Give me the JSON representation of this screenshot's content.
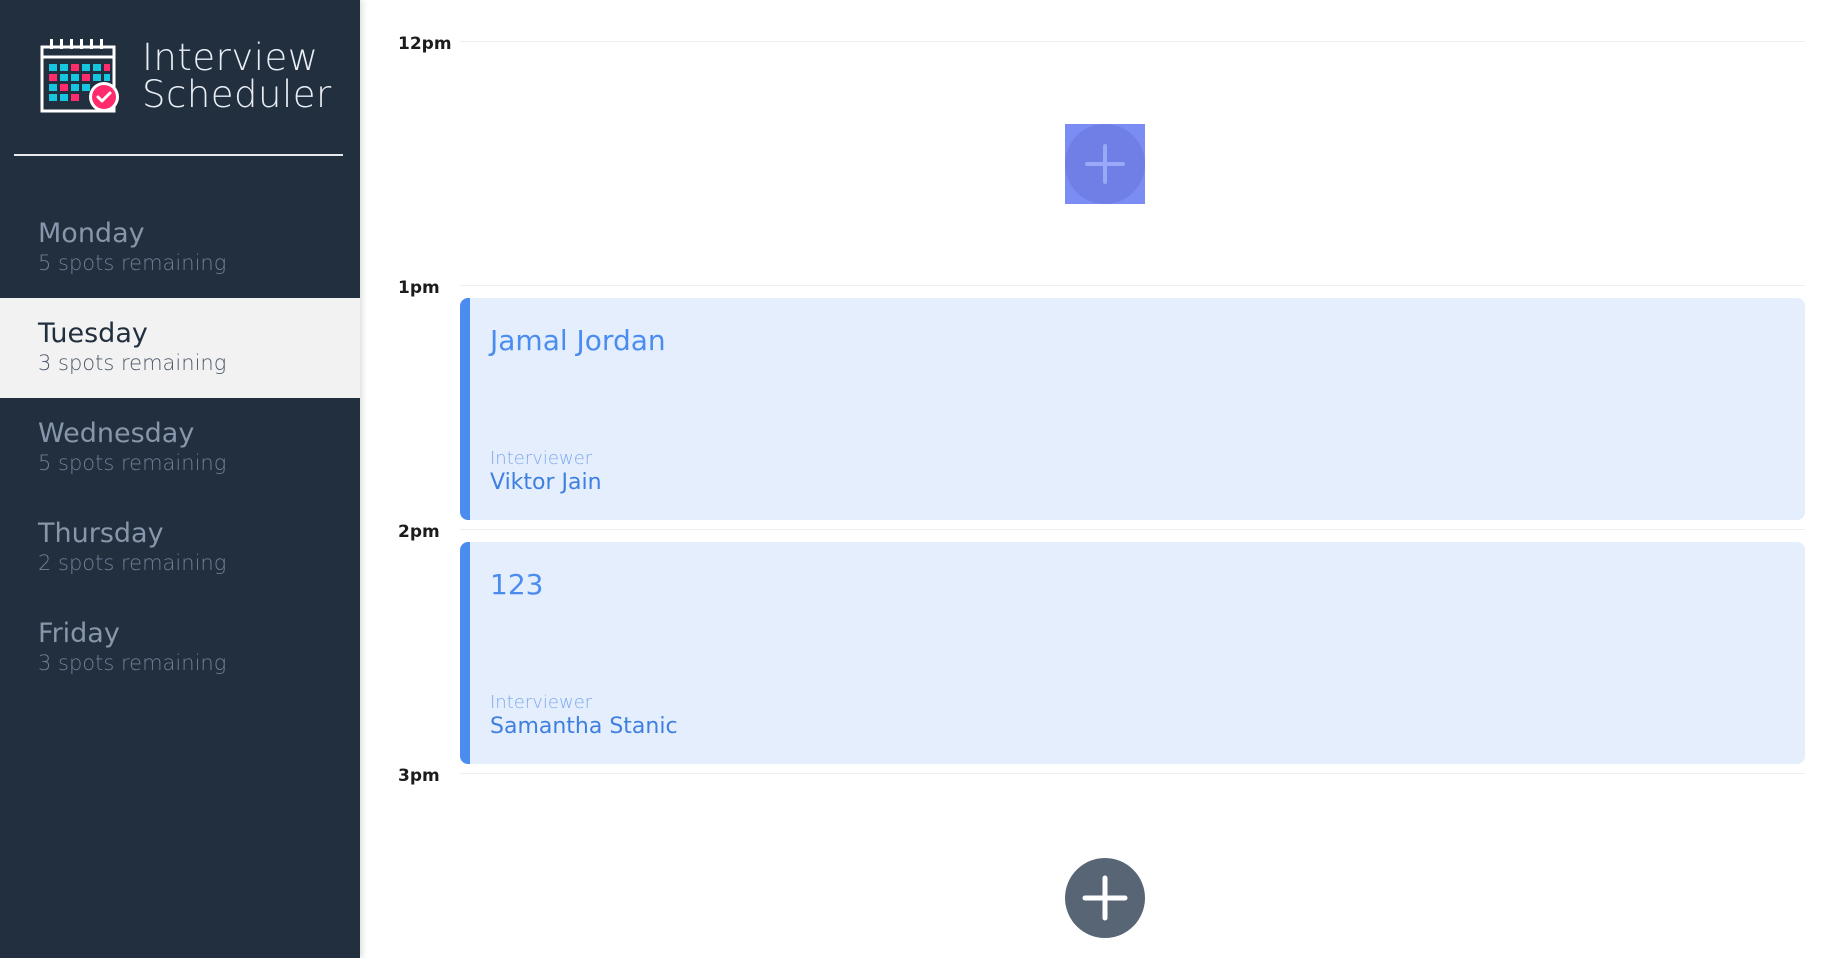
{
  "brand": {
    "title_line1": "Interview",
    "title_line2": "Scheduler",
    "logo_icon": "calendar-check-icon",
    "logo_colors": [
      "#ffffff",
      "#ff2b6c",
      "#16c6e0"
    ]
  },
  "sidebar": {
    "days": [
      {
        "name": "Monday",
        "spots": "5 spots remaining",
        "selected": false
      },
      {
        "name": "Tuesday",
        "spots": "3 spots remaining",
        "selected": true
      },
      {
        "name": "Wednesday",
        "spots": "5 spots remaining",
        "selected": false
      },
      {
        "name": "Thursday",
        "spots": "2 spots remaining",
        "selected": false
      },
      {
        "name": "Friday",
        "spots": "3 spots remaining",
        "selected": false
      }
    ]
  },
  "schedule": {
    "times": [
      "12pm",
      "1pm",
      "2pm",
      "3pm"
    ],
    "add_icon": "plus-circle-icon",
    "appointments": [
      {
        "student": "Jamal Jordan",
        "interviewer_label": "Interviewer",
        "interviewer": "Viktor Jain"
      },
      {
        "student": "123",
        "interviewer_label": "Interviewer",
        "interviewer": "Samantha Stanic"
      }
    ]
  },
  "colors": {
    "sidebar_bg": "#222f3e",
    "selected_bg": "#f2f2f2",
    "appointment_bg": "#e4eefc",
    "appointment_accent": "#4a8cf0",
    "add_button": "#576574",
    "add_button_highlight": "#7b8cf5"
  }
}
